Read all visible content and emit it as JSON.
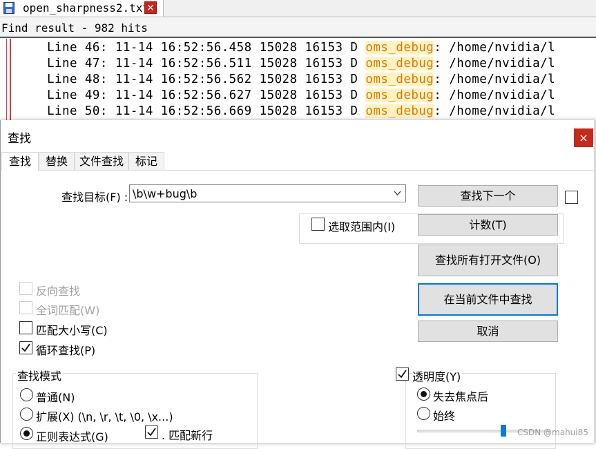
{
  "editor": {
    "tab_name": "open_sharpness2.txt",
    "tab_close_glyph": "✕",
    "find_result": "Find result - 982 hits",
    "lines": [
      {
        "prefix": "Line 46: 11-14 16:52:56.458 15028 16153 D ",
        "match": "oms_debug",
        "suffix": ": /home/nvidia/l"
      },
      {
        "prefix": "Line 47: 11-14 16:52:56.511 15028 16153 D ",
        "match": "oms_debug",
        "suffix": ": /home/nvidia/l"
      },
      {
        "prefix": "Line 48: 11-14 16:52:56.562 15028 16153 D ",
        "match": "oms_debug",
        "suffix": ": /home/nvidia/l"
      },
      {
        "prefix": "Line 49: 11-14 16:52:56.627 15028 16153 D ",
        "match": "oms_debug",
        "suffix": ": /home/nvidia/l"
      },
      {
        "prefix": "Line 50: 11-14 16:52:56.669 15028 16153 D ",
        "match": "oms_debug",
        "suffix": ": /home/nvidia/l"
      }
    ]
  },
  "dialog": {
    "title": "查找",
    "close_glyph": "×",
    "tabs": [
      "查找",
      "替换",
      "文件查找",
      "标记"
    ],
    "target_label": "查找目标(F) :",
    "target_value": "\\b\\w+bug\\b",
    "in_selection_label": "选取范围内(I)",
    "buttons": {
      "find_next": "查找下一个",
      "count": "计数(T)",
      "find_all_open": "查找所有打开文件(O)",
      "find_in_current": "在当前文件中查找",
      "cancel": "取消"
    },
    "options": {
      "backward": "反向查找",
      "whole_word": "全词匹配(W)",
      "match_case": "匹配大小写(C)",
      "wrap": "循环查找(P)"
    },
    "search_mode": {
      "title": "查找模式",
      "normal": "普通(N)",
      "extended": "扩展(X) (\\n, \\r, \\t, \\0, \\x...)",
      "regex": "正则表达式(G)",
      "dot_newline": ". 匹配新行",
      "selected": "regex"
    },
    "transparency": {
      "label": "透明度(Y)",
      "on_lose_focus": "失去焦点后",
      "always": "始终",
      "selected": "on_lose_focus",
      "slider_level": 0.63
    }
  },
  "watermark": "CSDN @mahui85",
  "colors": {
    "match_bg": "#fdf2c4",
    "match_fg": "#e07900",
    "close_red": "#c42b1c",
    "accent_blue": "#0078d7"
  }
}
